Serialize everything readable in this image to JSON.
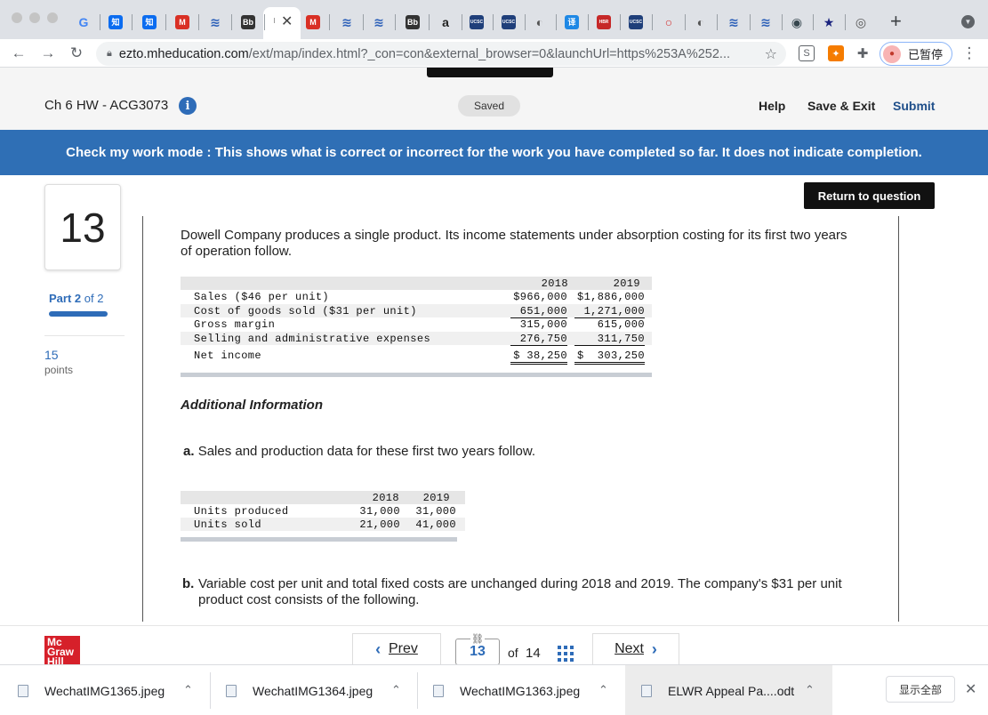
{
  "browser": {
    "tabs": [
      {
        "icon": "google-icon",
        "glyph": "G",
        "color": "#4285f4"
      },
      {
        "icon": "zhihu-icon",
        "glyph": "知",
        "color": "#0b6cf0"
      },
      {
        "icon": "zhihu-icon",
        "glyph": "知",
        "color": "#0b6cf0"
      },
      {
        "icon": "gmail-icon",
        "glyph": "M",
        "color": "#d93025"
      },
      {
        "icon": "blue-stripes-icon",
        "glyph": "≋",
        "color": "#2b5fb8"
      },
      {
        "icon": "blackboard-icon",
        "glyph": "Bb",
        "color": "#333333"
      },
      {
        "icon": "gmail-icon",
        "glyph": "M",
        "color": "#d93025"
      },
      {
        "icon": "blue-stripes-icon",
        "glyph": "≋",
        "color": "#2b5fb8"
      },
      {
        "icon": "blue-stripes-icon",
        "glyph": "≋",
        "color": "#2b5fb8"
      },
      {
        "icon": "blackboard-icon",
        "glyph": "Bb",
        "color": "#333333"
      },
      {
        "icon": "amazon-icon",
        "glyph": "a",
        "color": "#222222"
      },
      {
        "icon": "ucsc-icon",
        "glyph": "UCSC",
        "color": "#1f3f7a"
      },
      {
        "icon": "ucsc-icon",
        "glyph": "UCSC",
        "color": "#1f3f7a"
      },
      {
        "icon": "globe-icon",
        "glyph": "◐",
        "color": "#555555"
      },
      {
        "icon": "translate-icon",
        "glyph": "译",
        "color": "#1e88e5"
      },
      {
        "icon": "hbr-icon",
        "glyph": "HBR",
        "color": "#c62828"
      },
      {
        "icon": "ucsc-icon",
        "glyph": "UCSC",
        "color": "#1f3f7a"
      },
      {
        "icon": "red-circle-icon",
        "glyph": "○",
        "color": "#d32f2f"
      },
      {
        "icon": "globe-icon",
        "glyph": "◐",
        "color": "#555555"
      },
      {
        "icon": "blue-stripes-icon",
        "glyph": "≋",
        "color": "#2b5fb8"
      },
      {
        "icon": "blue-stripes-icon",
        "glyph": "≋",
        "color": "#2b5fb8"
      },
      {
        "icon": "badge-icon",
        "glyph": "◉",
        "color": "#37474f"
      },
      {
        "icon": "star-icon",
        "glyph": "★",
        "color": "#1a237e"
      },
      {
        "icon": "chrome-icon",
        "glyph": "◎",
        "color": "#555555"
      }
    ],
    "new_tab": "+",
    "url_host": "ezto.mheducation.com",
    "url_rest": "/ext/map/index.html?_con=con&external_browser=0&launchUrl=https%253A%252...",
    "profile_label": "已暂停"
  },
  "header": {
    "title": "Ch 6 HW - ACG3073",
    "saved": "Saved",
    "help": "Help",
    "save_exit": "Save & Exit",
    "submit": "Submit"
  },
  "banner": "Check my work mode : This shows what is correct or incorrect for the work you have completed so far. It does not indicate completion.",
  "rail": {
    "question_number": "13",
    "part_word": "Part",
    "part_num": "2",
    "part_of": "of 2",
    "points": "15",
    "points_label": "points"
  },
  "return_button": "Return to question",
  "content": {
    "intro": "Dowell Company produces a single product. Its income statements under absorption costing for its first two years of operation follow.",
    "income_table": {
      "years": [
        "2018",
        "2019"
      ],
      "rows": [
        {
          "label": "Sales ($46 per unit)",
          "v2018": "$966,000",
          "v2019": "$1,886,000"
        },
        {
          "label": "Cost of goods sold ($31 per unit)",
          "v2018": "651,000",
          "v2019": "1,271,000"
        },
        {
          "label": "Gross margin",
          "v2018": "315,000",
          "v2019": "615,000"
        },
        {
          "label": "Selling and administrative expenses",
          "v2018": "276,750",
          "v2019": "311,750"
        },
        {
          "label": "Net income",
          "v2018": "$ 38,250",
          "v2019": "$  303,250"
        }
      ]
    },
    "additional_info": "Additional Information",
    "part_a_letter": "a.",
    "part_a": "Sales and production data for these first two years follow.",
    "units_table": {
      "years": [
        "2018",
        "2019"
      ],
      "rows": [
        {
          "label": "Units produced",
          "v2018": "31,000",
          "v2019": "31,000"
        },
        {
          "label": "Units sold",
          "v2018": "21,000",
          "v2019": "41,000"
        }
      ]
    },
    "part_b_letter": "b.",
    "part_b": "Variable cost per unit and total fixed costs are unchanged during 2018 and 2019. The company's $31 per unit product cost consists of the following."
  },
  "nav": {
    "logo": "Mc Graw Hill",
    "prev": "Prev",
    "current_page": "13",
    "of": "of",
    "total_pages": "14",
    "next": "Next"
  },
  "downloads": {
    "items": [
      "WechatIMG1365.jpeg",
      "WechatIMG1364.jpeg",
      "WechatIMG1363.jpeg",
      "ELWR  Appeal Pa....odt"
    ],
    "show_all": "显示全部"
  }
}
